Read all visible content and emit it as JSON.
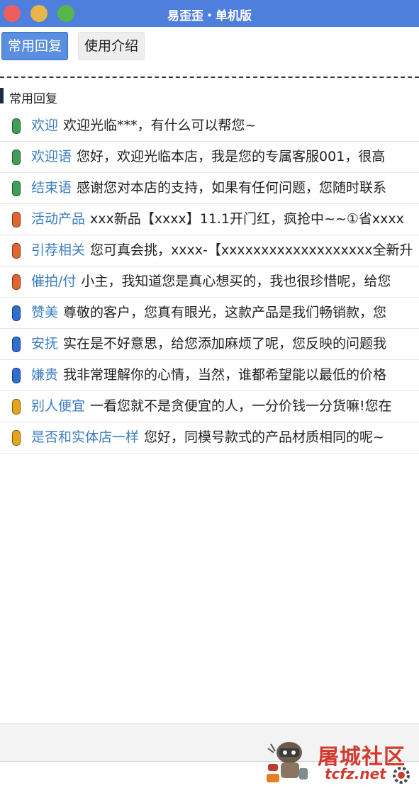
{
  "window": {
    "title": "易歪歪・单机版",
    "controls": [
      "close",
      "minimize",
      "maximize"
    ]
  },
  "tabs": [
    {
      "label": "常用回复",
      "active": true
    },
    {
      "label": "使用介绍",
      "active": false
    }
  ],
  "section": {
    "title": "常用回复"
  },
  "colors": {
    "green": "#3f9f56",
    "orange": "#e3652e",
    "blue": "#2e6fd2",
    "gold": "#e4a519",
    "keyword": "#3b7ec2"
  },
  "replies": [
    {
      "keyword": "欢迎",
      "content": "欢迎光临***，有什么可以帮您~",
      "color": "green"
    },
    {
      "keyword": "欢迎语",
      "content": "您好，欢迎光临本店，我是您的专属客服001，很高",
      "color": "green"
    },
    {
      "keyword": "结束语",
      "content": "感谢您对本店的支持，如果有任何问题，您随时联系",
      "color": "green"
    },
    {
      "keyword": "活动产品",
      "content": "xxx新品【xxxx】11.1开门红，疯抢中~~①省xxxx",
      "color": "orange"
    },
    {
      "keyword": "引荐相关",
      "content": "您可真会挑，xxxx-【xxxxxxxxxxxxxxxxxxx全新升",
      "color": "orange"
    },
    {
      "keyword": "催拍/付",
      "content": "小主，我知道您是真心想买的，我也很珍惜呢，给您",
      "color": "orange"
    },
    {
      "keyword": "赞美",
      "content": "尊敬的客户，您真有眼光，这款产品是我们畅销款，您",
      "color": "blue"
    },
    {
      "keyword": "安抚",
      "content": "实在是不好意思，给您添加麻烦了呢，您反映的问题我",
      "color": "blue"
    },
    {
      "keyword": "嫌贵",
      "content": "我非常理解你的心情，当然，谁都希望能以最低的价格",
      "color": "blue"
    },
    {
      "keyword": "别人便宜",
      "content": "一看您就不是贪便宜的人，一分价钱一分货嘛!您在",
      "color": "gold"
    },
    {
      "keyword": "是否和实体店一样",
      "content": "您好，同模号款式的产品材质相同的呢~",
      "color": "gold"
    }
  ],
  "watermark": {
    "title": "屠城社区",
    "subtitle": "tcfz.net",
    "mascot": "robot-mascot-icon",
    "gear": "gear-icon"
  }
}
